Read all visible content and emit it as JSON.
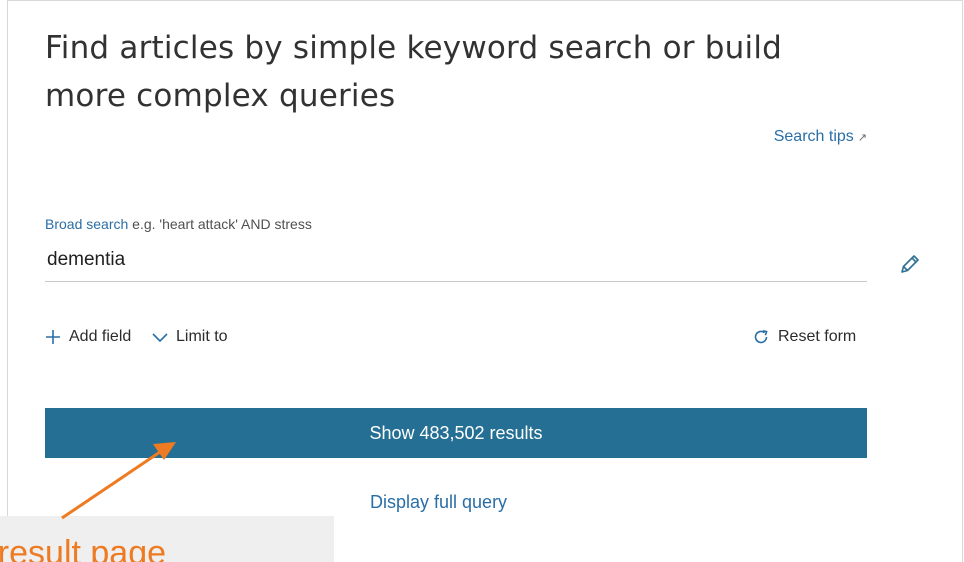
{
  "heading": "Find articles by simple keyword search or build more complex queries",
  "search_tips": {
    "label": "Search tips",
    "icon": "external-arrow-icon"
  },
  "broad_search": {
    "label": "Broad search",
    "hint": " e.g. 'heart attack' AND stress",
    "value": "dementia",
    "edit_icon": "pencil-icon"
  },
  "actions": {
    "add_field": "Add field",
    "limit_to": "Limit to",
    "reset_form": "Reset form"
  },
  "show_results": "Show 483,502 results",
  "display_full_query": "Display full query",
  "callout": {
    "text": "to result page",
    "color": "#ee7b22"
  },
  "colors": {
    "primary_button": "#246f93",
    "link": "#2a6ea6",
    "annotation": "#ee7b22"
  }
}
